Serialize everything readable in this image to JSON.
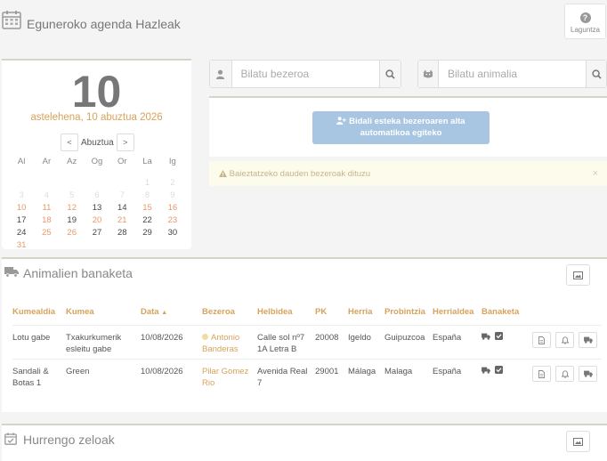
{
  "header": {
    "title": "Eguneroko agenda Hazleak",
    "help_label": "Laguntza"
  },
  "calendar": {
    "day": "10",
    "date_label": "astelehena, 10 abuztua 2026",
    "month": "Abuztua",
    "prev": "<",
    "next": ">",
    "weekdays": [
      "Al",
      "Ar",
      "Az",
      "Og",
      "Or",
      "La",
      "Ig"
    ],
    "weeks": [
      [
        "",
        "",
        "",
        "",
        "",
        "1",
        "2"
      ],
      [
        "3",
        "4",
        "5",
        "6",
        "7",
        "8",
        "9"
      ],
      [
        "10",
        "11",
        "12",
        "13",
        "14",
        "15",
        "16"
      ],
      [
        "17",
        "18",
        "19",
        "20",
        "21",
        "22",
        "23"
      ],
      [
        "24",
        "25",
        "26",
        "27",
        "28",
        "29",
        "30"
      ],
      [
        "31",
        "",
        "",
        "",
        "",
        "",
        ""
      ]
    ]
  },
  "search_client": {
    "placeholder": "Bilatu bezeroa"
  },
  "search_animal": {
    "placeholder": "Bilatu animalia"
  },
  "send_button": {
    "line1": "Bidali esteka bezeroaren alta",
    "line2": "automatikoa egiteko"
  },
  "alert": {
    "text": "Baieztatzeko dauden bezeroak dituzu",
    "close": "×"
  },
  "distribution": {
    "title": "Animalien banaketa",
    "columns": [
      "Kumealdia",
      "Kumea",
      "Data",
      "Bezeroa",
      "Helbidea",
      "PK",
      "Herria",
      "Probintzia",
      "Herrialdea",
      "Banaketa"
    ],
    "sort_indicator": "▲",
    "rows": [
      {
        "kumealdia": [
          "Lotu gabe"
        ],
        "kumea": [
          "Txakurkumerik",
          "esleitu gabe"
        ],
        "data": "10/08/2026",
        "bezeroa": [
          "Antonio",
          "Banderas"
        ],
        "helbidea": [
          "Calle sol nº7",
          "1A Letra B"
        ],
        "pk": "20008",
        "herria": "Igeldo",
        "probintzia": "Guipuzcoa",
        "herrialdea": "España"
      },
      {
        "kumealdia": [
          "Sandali &",
          "Botas 1"
        ],
        "kumea": [
          "Green"
        ],
        "data": "10/08/2026",
        "bezeroa": [
          "Pilar Gomez",
          "Rio"
        ],
        "helbidea": [
          "Avenida Real",
          "7"
        ],
        "pk": "29001",
        "herria": "Málaga",
        "probintzia": "Malaga",
        "herrialdea": "España"
      }
    ]
  },
  "next_heats": {
    "title": "Hurrengo zeloak"
  }
}
